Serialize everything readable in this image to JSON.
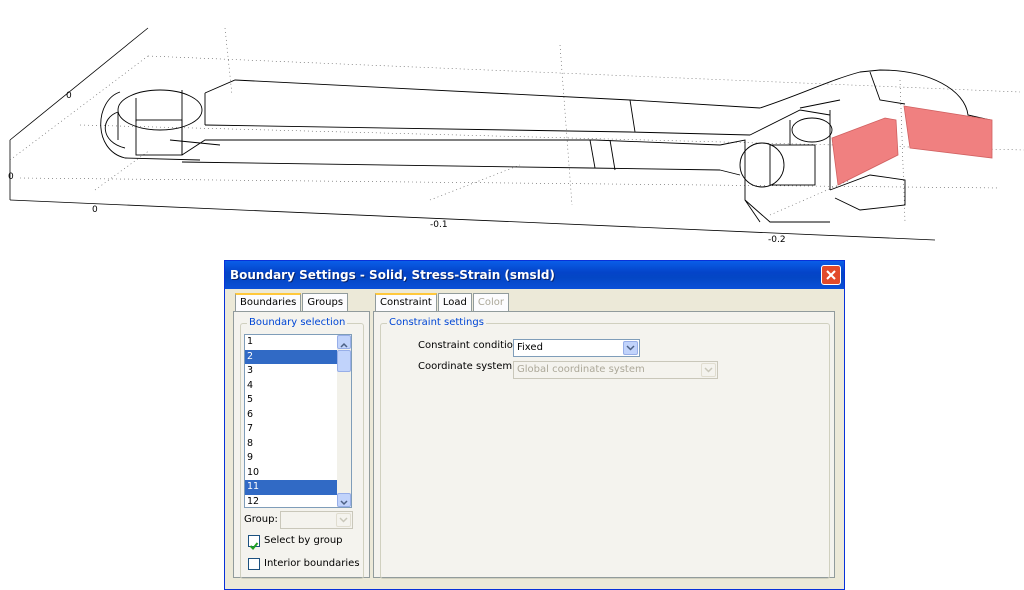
{
  "viewport": {
    "axis_labels": [
      "0",
      "0",
      "0",
      "-0.1",
      "-0.2"
    ],
    "highlight_color": "#f08080"
  },
  "dialog": {
    "title": "Boundary Settings - Solid, Stress-Strain (smsld)",
    "close_icon": "close-x-icon",
    "left_tabs": [
      "Boundaries",
      "Groups"
    ],
    "right_tabs": [
      "Constraint",
      "Load",
      "Color"
    ],
    "boundary_selection": {
      "legend": "Boundary selection",
      "items": [
        "1",
        "2",
        "3",
        "4",
        "5",
        "6",
        "7",
        "8",
        "9",
        "10",
        "11",
        "12"
      ],
      "selected": [
        "2",
        "11"
      ],
      "group_label": "Group:",
      "group_value": "",
      "select_by_group_label": "Select by group",
      "select_by_group_checked": true,
      "interior_boundaries_label": "Interior boundaries",
      "interior_boundaries_checked": false
    },
    "constraint_settings": {
      "legend": "Constraint settings",
      "condition_label": "Constraint condition:",
      "condition_value": "Fixed",
      "coord_label": "Coordinate system:",
      "coord_value": "Global coordinate system"
    },
    "colors": {
      "title_bar": "#0a5ee8",
      "selection": "#316ac5",
      "legend": "#0046d5",
      "dialog_bg": "#ece9d8"
    }
  }
}
